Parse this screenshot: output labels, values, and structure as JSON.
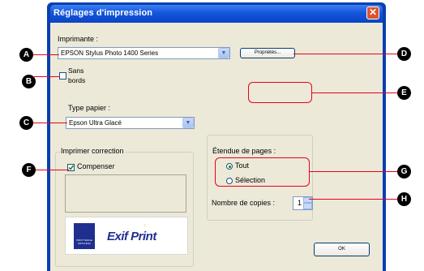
{
  "window": {
    "title": "Réglages d'impression"
  },
  "printer": {
    "label": "Imprimante :",
    "selected": "EPSON Stylus Photo 1400 Series",
    "properties_label": "Propriétés..."
  },
  "borderless": {
    "label_line1": "Sans",
    "label_line2": "bords"
  },
  "paper": {
    "label": "Type papier :",
    "selected": "Epson Ultra Glacé"
  },
  "correction": {
    "group_label": "Imprimer correction",
    "compensate_label": "Compenser"
  },
  "logos": {
    "exif_print": "Exif Print",
    "print_image_matching": "PRINT IMAGE MATCHING"
  },
  "pages": {
    "group_label": "Étendue de pages :",
    "all_label": "Tout",
    "selection_label": "Sélection"
  },
  "copies": {
    "label": "Nombre de copies :",
    "value": "1"
  },
  "ok_label": "OK",
  "callouts": {
    "a": "A",
    "b": "B",
    "c": "C",
    "d": "D",
    "e": "E",
    "f": "F",
    "g": "G",
    "h": "H"
  },
  "colors": {
    "callout_line": "#e8001c",
    "title_bar": "#0a44c6",
    "dialog_bg": "#ece9d8"
  }
}
